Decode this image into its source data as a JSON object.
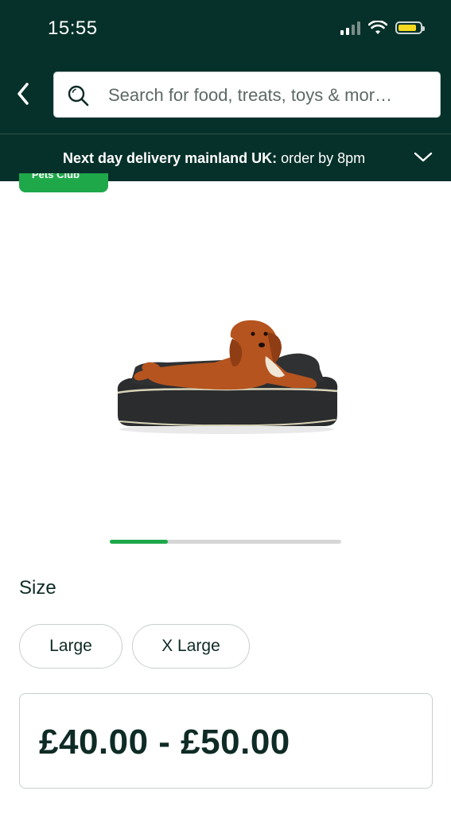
{
  "status_bar": {
    "time": "15:55"
  },
  "search": {
    "placeholder": "Search for food, treats, toys & mor…"
  },
  "delivery": {
    "bold_text": "Next day delivery mainland UK:",
    "text": " order by 8pm"
  },
  "badge": {
    "label": "Pets Club"
  },
  "carousel": {
    "progress": 0.25
  },
  "size": {
    "label": "Size",
    "options": [
      "Large",
      "X Large"
    ]
  },
  "price": {
    "range": "£40.00 - £50.00"
  },
  "colors": {
    "header": "#06312a",
    "accent": "#1ea84a",
    "battery": "#f6d91f"
  },
  "icons": [
    "back-chevron-icon",
    "search-icon",
    "chevron-down-icon",
    "signal-icon",
    "wifi-icon",
    "battery-icon"
  ]
}
